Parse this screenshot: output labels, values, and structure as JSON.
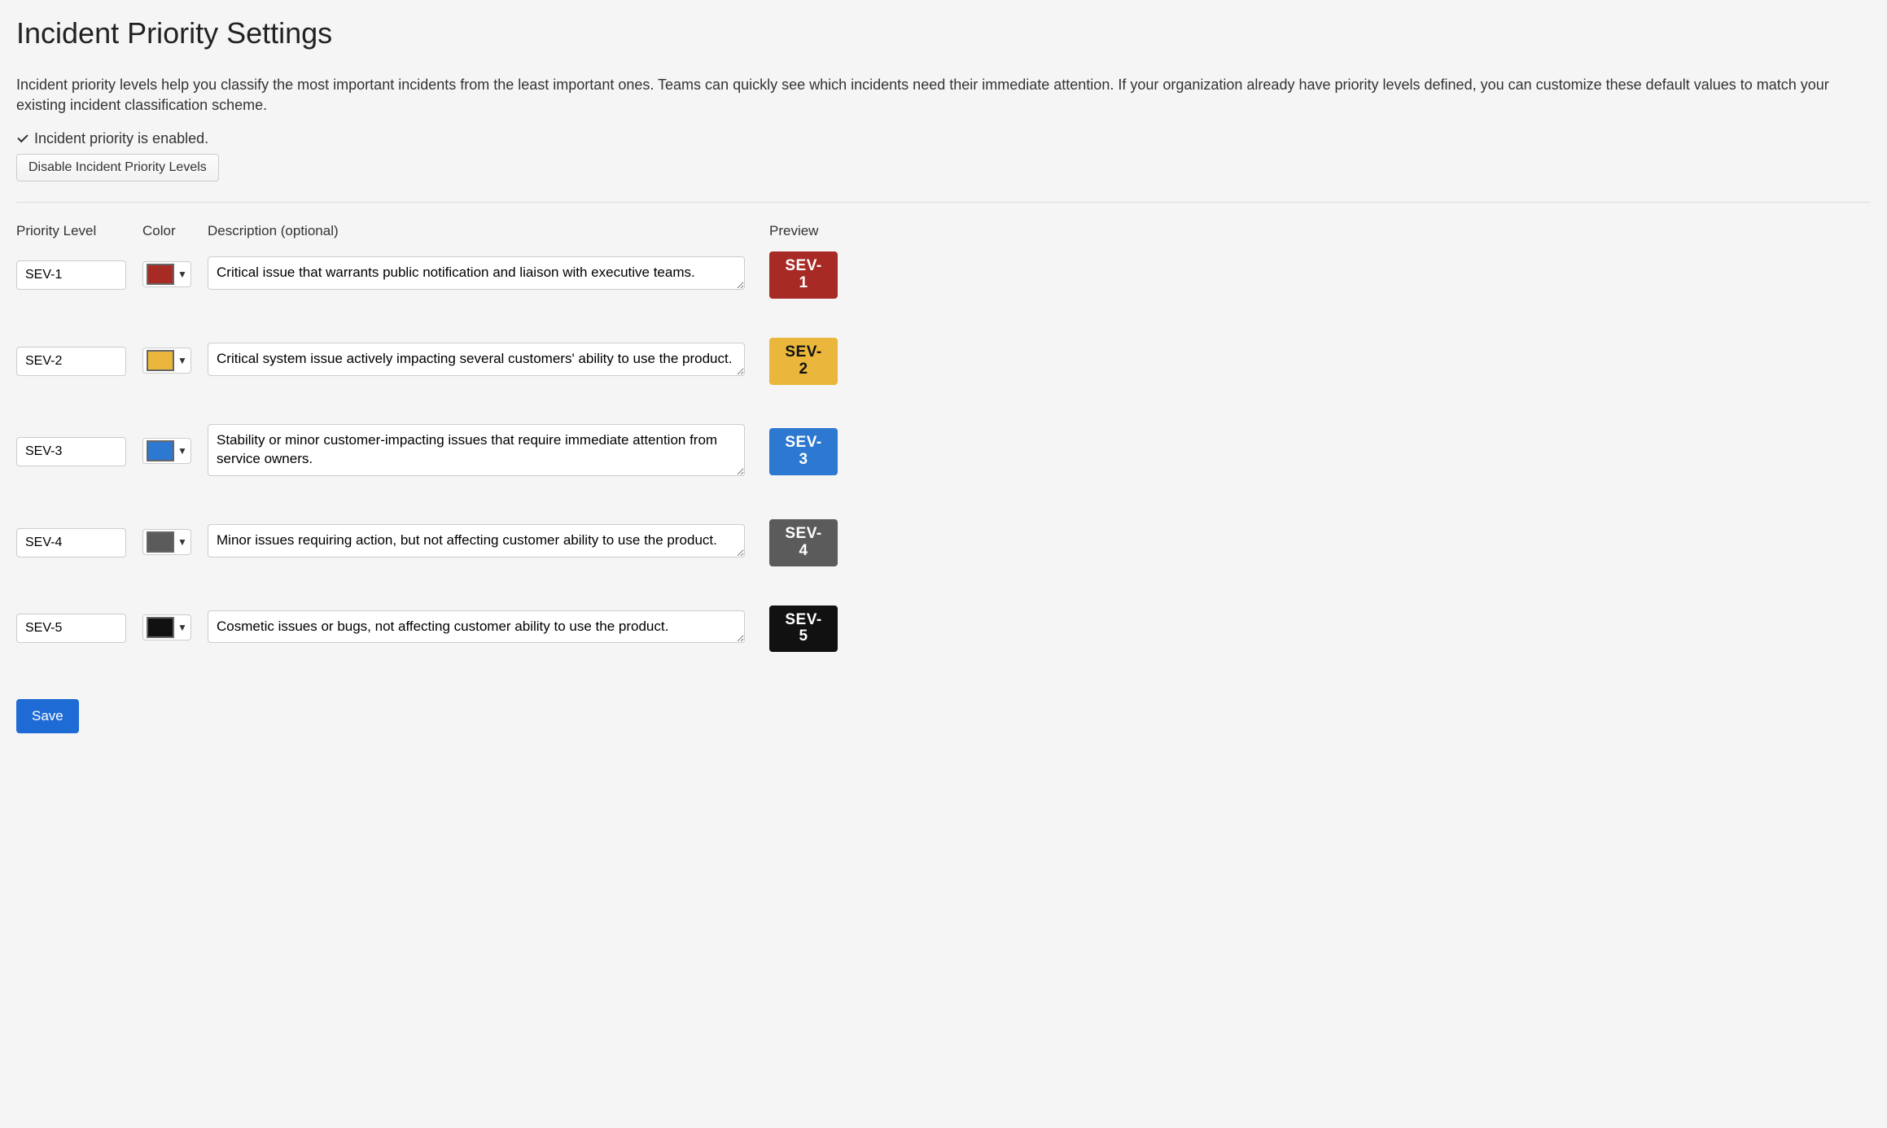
{
  "page_title": "Incident Priority Settings",
  "intro_text": "Incident priority levels help you classify the most important incidents from the least important ones. Teams can quickly see which incidents need their immediate attention. If your organization already have priority levels defined, you can customize these default values to match your existing incident classification scheme.",
  "status_label": "Incident priority is enabled.",
  "disable_button_label": "Disable Incident Priority Levels",
  "columns": {
    "level": "Priority Level",
    "color": "Color",
    "description": "Description (optional)",
    "preview": "Preview"
  },
  "priorities": [
    {
      "level": "SEV-1",
      "color": "#a82a24",
      "description": "Critical issue that warrants public notification and liaison with executive teams.",
      "preview_text": "SEV-1",
      "text_color": "#ffffff"
    },
    {
      "level": "SEV-2",
      "color": "#eab73c",
      "description": "Critical system issue actively impacting several customers' ability to use the product.",
      "preview_text": "SEV-2",
      "text_color": "#111111"
    },
    {
      "level": "SEV-3",
      "color": "#2d78d0",
      "description": "Stability or minor customer-impacting issues that require immediate attention from service owners.",
      "preview_text": "SEV-3",
      "text_color": "#ffffff"
    },
    {
      "level": "SEV-4",
      "color": "#5b5b5b",
      "description": "Minor issues requiring action, but not affecting customer ability to use the product.",
      "preview_text": "SEV-4",
      "text_color": "#ffffff"
    },
    {
      "level": "SEV-5",
      "color": "#111111",
      "description": "Cosmetic issues or bugs, not affecting customer ability to use the product.",
      "preview_text": "SEV-5",
      "text_color": "#ffffff"
    }
  ],
  "save_button_label": "Save"
}
